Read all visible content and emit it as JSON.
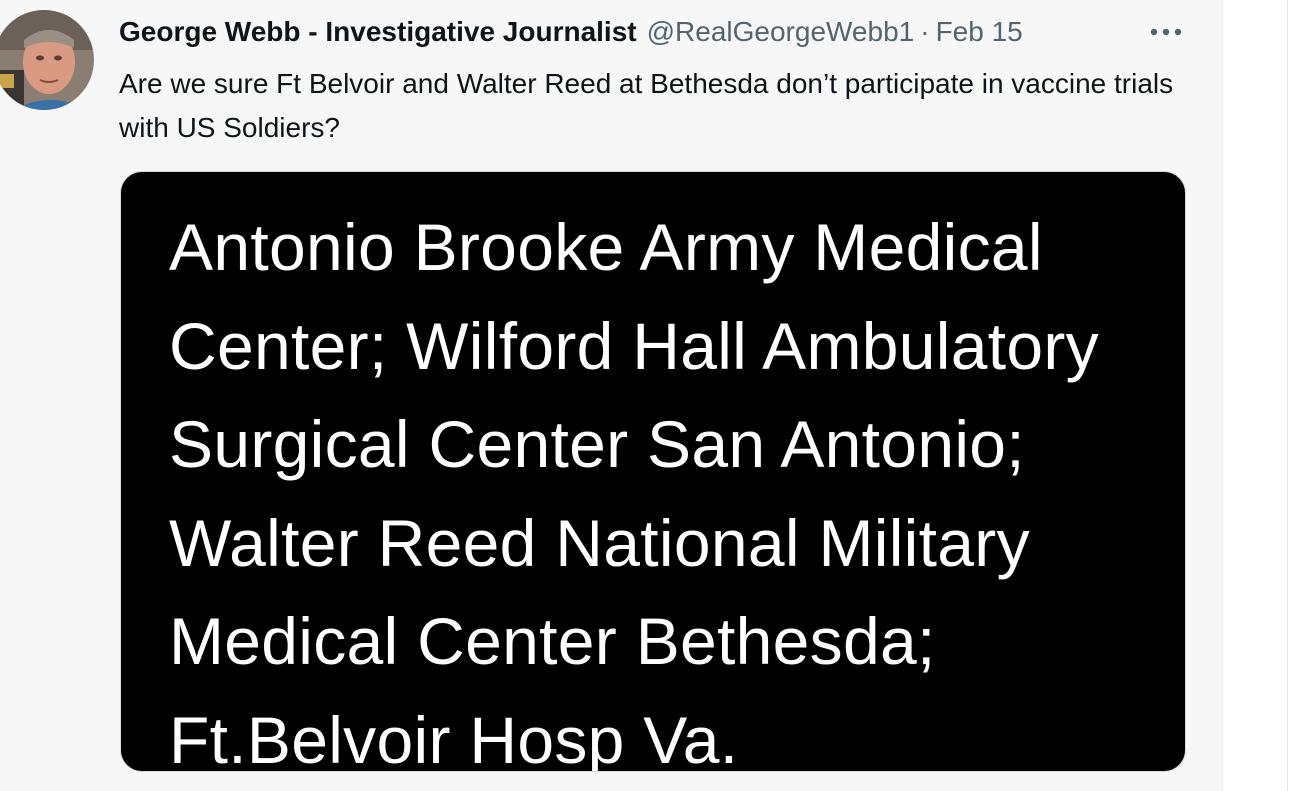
{
  "tweet": {
    "author_name": "George Webb - Investigative Journalist",
    "handle": "@RealGeorgeWebb1",
    "separator": "·",
    "date": "Feb 15",
    "more_icon": "more-horizontal-icon",
    "text": "Are we sure Ft Belvoir and Walter Reed at Bethesda don’t participate in vaccine trials with US Soldiers?",
    "avatar_icon": "profile-photo"
  },
  "media": {
    "lines": [
      "Antonio Brooke Army Medical",
      "Center; Wilford Hall Ambulatory",
      "Surgical Center San Antonio;",
      "Walter Reed National Military",
      "Medical Center Bethesda;",
      "Ft.Belvoir Hosp Va."
    ]
  },
  "colors": {
    "background": "#f7f7f8",
    "text_primary": "#0f1419",
    "text_secondary": "#536471",
    "media_background": "#000000",
    "media_text": "#ffffff"
  }
}
